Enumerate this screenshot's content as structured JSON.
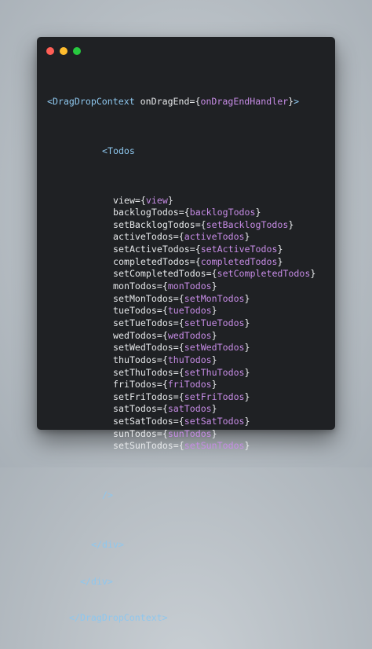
{
  "window": {
    "dots": [
      {
        "name": "close",
        "color": "#ff5f56"
      },
      {
        "name": "minimize",
        "color": "#ffbd2e"
      },
      {
        "name": "maximize",
        "color": "#27c93f"
      }
    ]
  },
  "colors": {
    "background": "#b5bcc2",
    "window": "#1f2124",
    "tag": "#8ec7ee",
    "attribute": "#e7e9eb",
    "value": "#c78ce6"
  },
  "code": {
    "opening_tag": "DragDropContext",
    "opening_attr": "onDragEnd",
    "opening_value": "onDragEndHandler",
    "component_tag": "Todos",
    "props": [
      {
        "name": "view",
        "value": "view"
      },
      {
        "name": "backlogTodos",
        "value": "backlogTodos"
      },
      {
        "name": "setBacklogTodos",
        "value": "setBacklogTodos"
      },
      {
        "name": "activeTodos",
        "value": "activeTodos"
      },
      {
        "name": "setActiveTodos",
        "value": "setActiveTodos"
      },
      {
        "name": "completedTodos",
        "value": "completedTodos"
      },
      {
        "name": "setCompletedTodos",
        "value": "setCompletedTodos"
      },
      {
        "name": "monTodos",
        "value": "monTodos"
      },
      {
        "name": "setMonTodos",
        "value": "setMonTodos"
      },
      {
        "name": "tueTodos",
        "value": "tueTodos"
      },
      {
        "name": "setTueTodos",
        "value": "setTueTodos"
      },
      {
        "name": "wedTodos",
        "value": "wedTodos"
      },
      {
        "name": "setWedTodos",
        "value": "setWedTodos"
      },
      {
        "name": "thuTodos",
        "value": "thuTodos"
      },
      {
        "name": "setThuTodos",
        "value": "setThuTodos"
      },
      {
        "name": "friTodos",
        "value": "friTodos"
      },
      {
        "name": "setFriTodos",
        "value": "setFriTodos"
      },
      {
        "name": "satTodos",
        "value": "satTodos"
      },
      {
        "name": "setSatTodos",
        "value": "setSatTodos"
      },
      {
        "name": "sunTodos",
        "value": "sunTodos"
      },
      {
        "name": "setSunTodos",
        "value": "setSunTodos"
      }
    ],
    "self_close": "/>",
    "closing_lines": [
      "</div>",
      "</div>",
      "</DragDropContext>"
    ]
  }
}
